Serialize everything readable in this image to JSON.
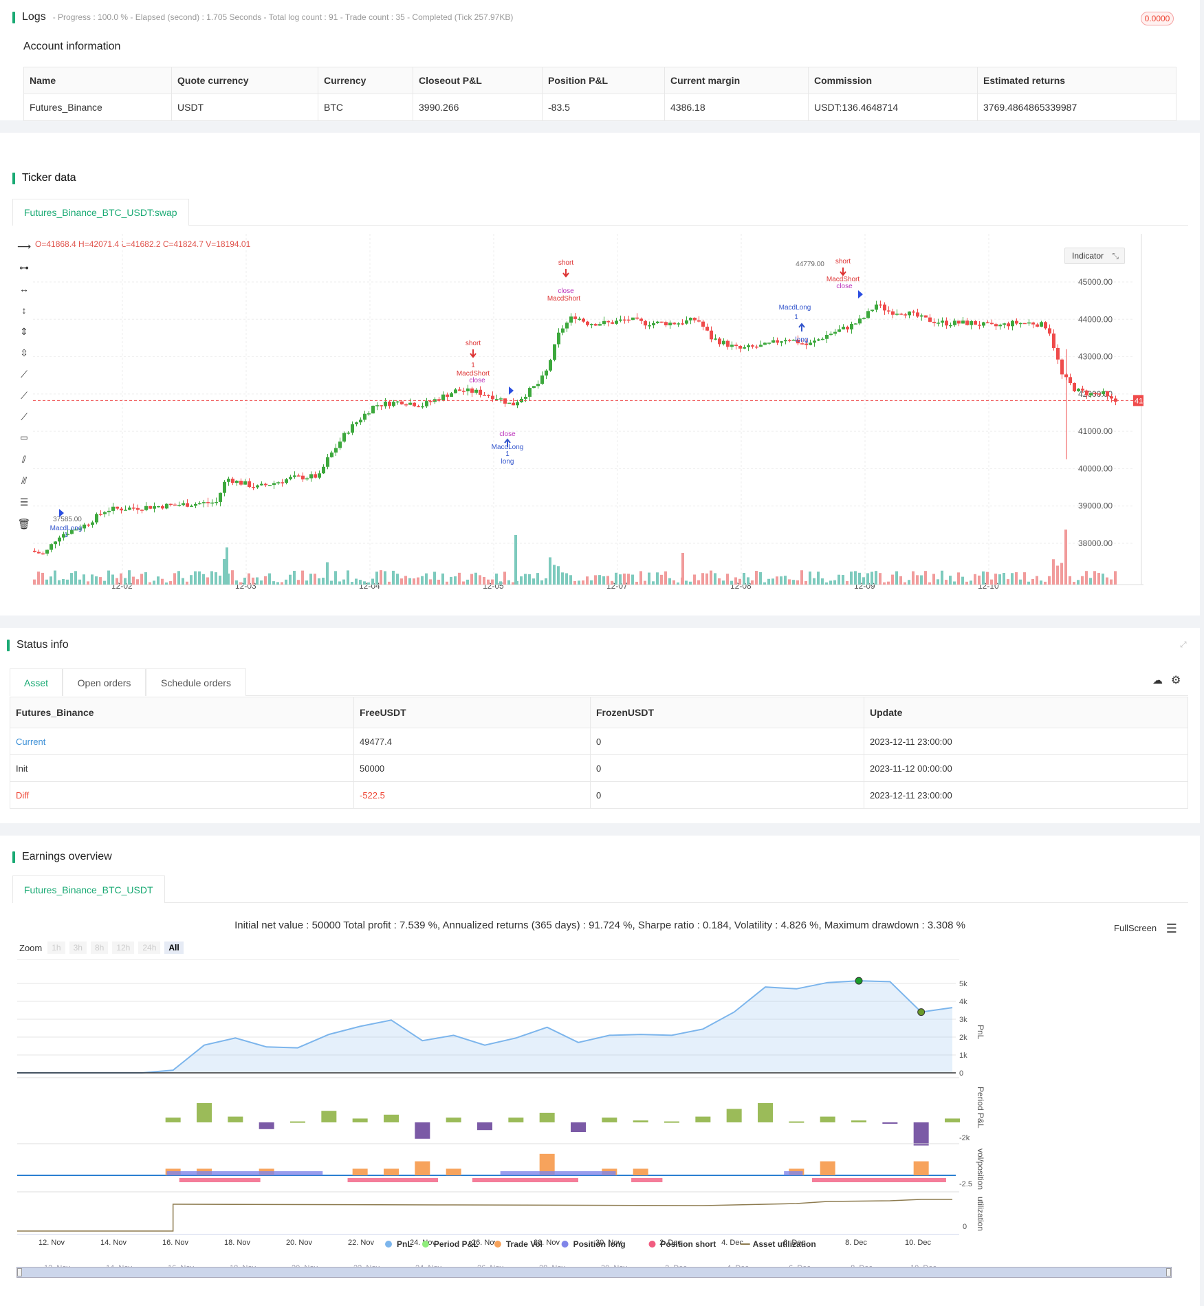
{
  "logs": {
    "title": "Logs",
    "summary": "- Progress : 100.0 % - Elapsed (second) : 1.705  Seconds - Total log count : 91 - Trade count : 35 - Completed (Tick 257.97KB)",
    "badge": "0.0000"
  },
  "account": {
    "title": "Account information",
    "headers": [
      "Name",
      "Quote currency",
      "Currency",
      "Closeout P&L",
      "Position P&L",
      "Current margin",
      "Commission",
      "Estimated returns"
    ],
    "row": [
      "Futures_Binance",
      "USDT",
      "BTC",
      "3990.266",
      "-83.5",
      "4386.18",
      "USDT:136.4648714",
      "3769.4864865339987"
    ]
  },
  "ticker": {
    "title": "Ticker data",
    "tab": "Futures_Binance_BTC_USDT:swap",
    "ohlc": "O=41868.4 H=42071.4 L=41682.2 C=41824.7 V=18194.01",
    "indicator_btn": "Indicator",
    "last_price": "41824.70",
    "price_ticks": [
      "45000.00",
      "44000.00",
      "43000.00",
      "42000.00",
      "41000.00",
      "40000.00",
      "39000.00",
      "38000.00"
    ],
    "date_ticks": [
      "12-02",
      "12-03",
      "12-04",
      "12-05",
      "12-07",
      "12-08",
      "12-09",
      "12-10"
    ],
    "annotations": {
      "short": "short",
      "one": "1",
      "macd_short": "MacdShort",
      "close": "close",
      "macd_long": "MacdLong",
      "long": "long",
      "low_label": "37585.00",
      "high_label": "44779.00"
    }
  },
  "status": {
    "title": "Status info",
    "tabs": [
      "Asset",
      "Open orders",
      "Schedule orders"
    ],
    "headers": [
      "Futures_Binance",
      "FreeUSDT",
      "FrozenUSDT",
      "Update"
    ],
    "rows": [
      {
        "name": "Current",
        "free": "49477.4",
        "frozen": "0",
        "update": "2023-12-11 23:00:00"
      },
      {
        "name": "Init",
        "free": "50000",
        "frozen": "0",
        "update": "2023-11-12 00:00:00"
      },
      {
        "name": "Diff",
        "free": "-522.5",
        "frozen": "0",
        "update": "2023-12-11 23:00:00"
      }
    ]
  },
  "earnings": {
    "title": "Earnings overview",
    "tab": "Futures_Binance_BTC_USDT",
    "summary": "Initial net value : 50000 Total profit : 7.539 %, Annualized returns (365 days) : 91.724 %, Sharpe ratio : 0.184, Volatility : 4.826 %, Maximum drawdown : 3.308 %",
    "fullscreen": "FullScreen",
    "zoom_label": "Zoom",
    "zoom_buttons": [
      "1h",
      "3h",
      "8h",
      "12h",
      "24h",
      "All"
    ],
    "pnl_ticks": [
      "5k",
      "4k",
      "3k",
      "2k",
      "1k",
      "0"
    ],
    "axis_titles": [
      "PnL",
      "Period P&L",
      "vol/position",
      "utilization"
    ],
    "period_tick": "-2k",
    "vol_tick": "-2.5",
    "util_tick": "0",
    "date_ticks": [
      "12. Nov",
      "14. Nov",
      "16. Nov",
      "18. Nov",
      "20. Nov",
      "22. Nov",
      "24. Nov",
      "26. Nov",
      "28. Nov",
      "30. Nov",
      "2. Dec",
      "4. Dec",
      "6. Dec",
      "8. Dec",
      "10. Dec"
    ],
    "legend": [
      {
        "label": "PnL",
        "color": "#7cb5ec"
      },
      {
        "label": "Period P&L",
        "color": "#90ed7d"
      },
      {
        "label": "Trade Vol",
        "color": "#f7a35c"
      },
      {
        "label": "Position long",
        "color": "#8085e9"
      },
      {
        "label": "Position short",
        "color": "#f15c80"
      },
      {
        "label": "Asset utilization",
        "color": "#8d7b4f"
      }
    ],
    "chart_data": {
      "type": "line",
      "x": [
        "12. Nov",
        "13. Nov",
        "14. Nov",
        "15. Nov",
        "16. Nov",
        "17. Nov",
        "18. Nov",
        "19. Nov",
        "20. Nov",
        "21. Nov",
        "22. Nov",
        "23. Nov",
        "24. Nov",
        "25. Nov",
        "26. Nov",
        "27. Nov",
        "28. Nov",
        "29. Nov",
        "30. Nov",
        "1. Dec",
        "2. Dec",
        "3. Dec",
        "4. Dec",
        "5. Dec",
        "6. Dec",
        "7. Dec",
        "8. Dec",
        "9. Dec",
        "10. Dec",
        "11. Dec"
      ],
      "series": [
        {
          "name": "PnL",
          "values": [
            0,
            0,
            0,
            0,
            0,
            150,
            1550,
            1950,
            1450,
            1400,
            2150,
            2600,
            2950,
            1800,
            2100,
            1550,
            1950,
            2550,
            1700,
            2100,
            2150,
            2100,
            2450,
            3400,
            4800,
            4700,
            5050,
            5150,
            5100,
            3400,
            3650
          ]
        }
      ],
      "ylim": [
        0,
        5500
      ]
    }
  }
}
